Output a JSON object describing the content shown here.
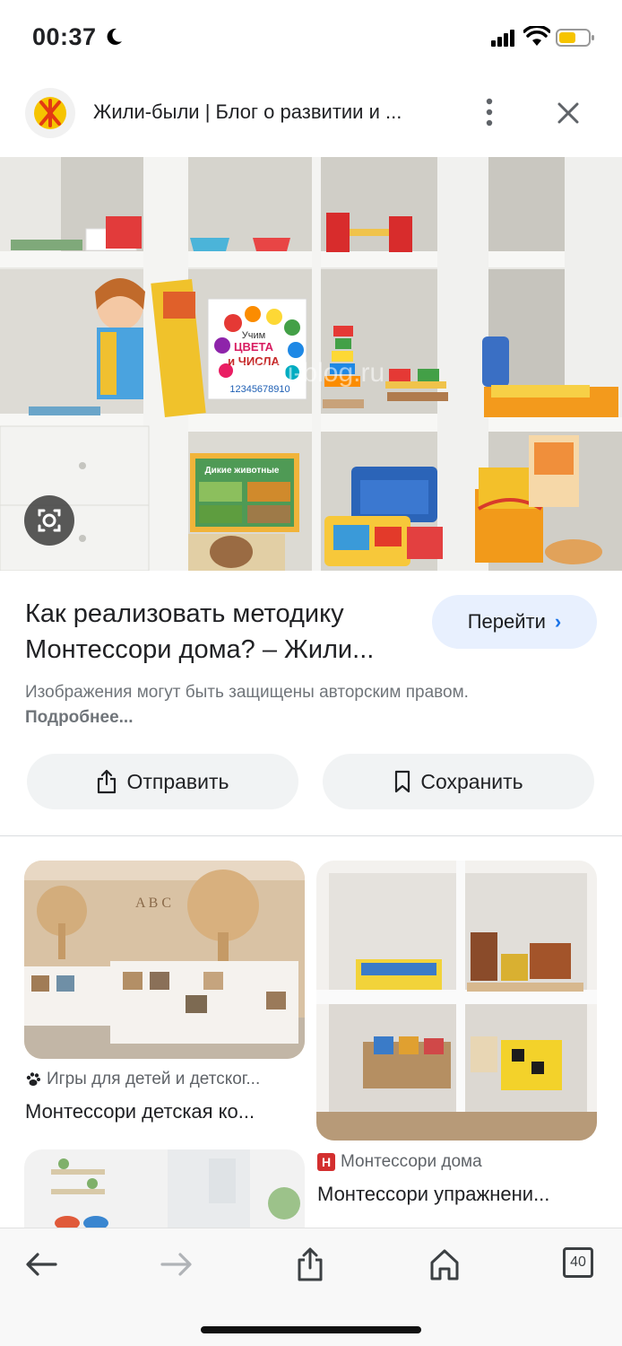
{
  "status": {
    "time": "00:37"
  },
  "header": {
    "title": "Жили-были | Блог о развитии и ...",
    "logo_icon": "site-logo-icon"
  },
  "result": {
    "title": "Как реализовать методику Монтессори дома? – Жили...",
    "go_label": "Перейти",
    "copyright_text": "Изображения могут быть защищены авторским правом.",
    "more_label": "Подробнее..."
  },
  "actions": {
    "send_label": "Отправить",
    "save_label": "Сохранить"
  },
  "hero_image": {
    "book_text_1": "Учим",
    "book_text_2": "ЦВЕТА",
    "book_text_3": "и ЧИСЛА",
    "book_text_4": "12345678910",
    "box_text": "Дикие животные",
    "watermark": "ilibili-blog.ru"
  },
  "related": [
    {
      "source": "Игры для детей и детског...",
      "title": "Монтессори детская ко..."
    },
    {
      "source": "Монтессори дома",
      "title": "Монтессори упражнени...",
      "source_badge": "Н"
    }
  ],
  "nav": {
    "tabs_count": "40"
  },
  "colors": {
    "accent": "#1a73e8",
    "go_button_bg": "#e8f0fe",
    "action_bg": "#f1f3f4",
    "battery": "#f6c400"
  }
}
